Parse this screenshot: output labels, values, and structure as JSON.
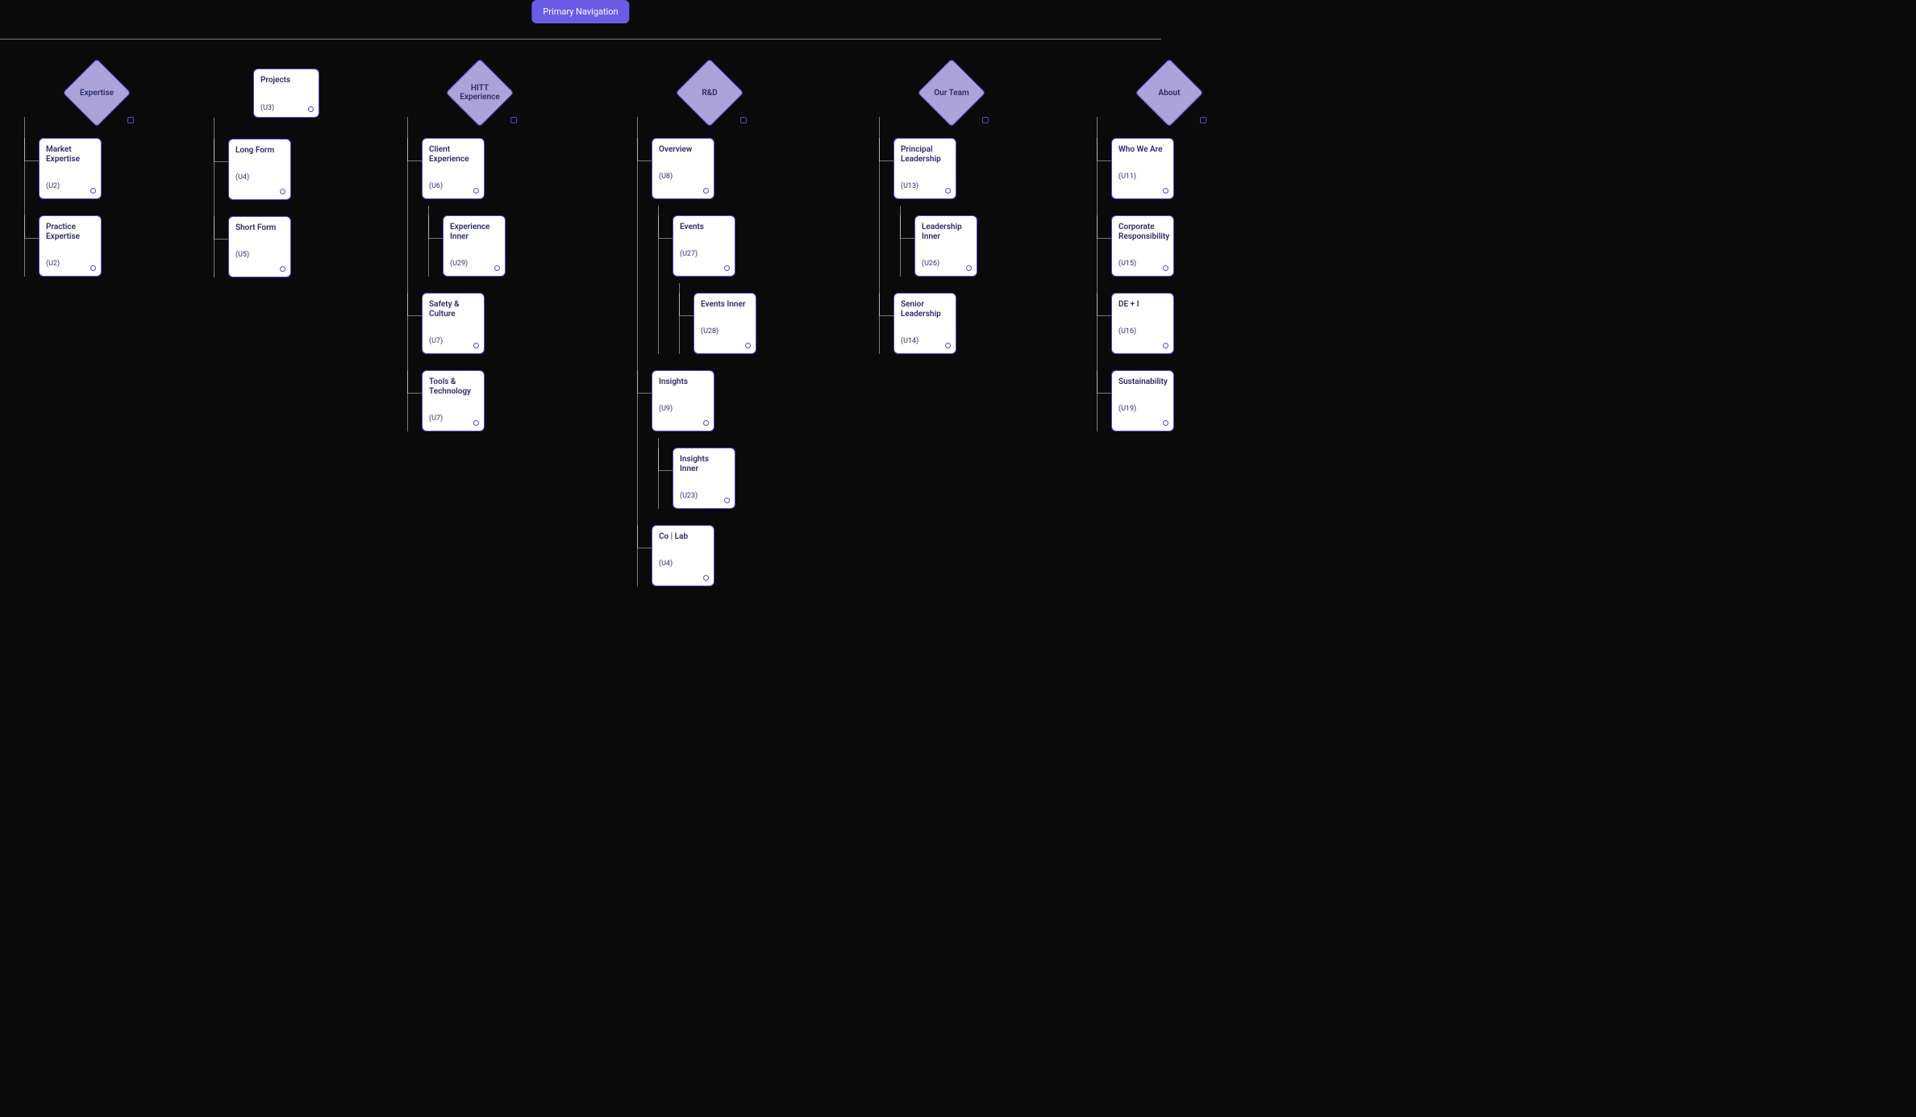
{
  "root_label": "Primary Navigation",
  "colors": {
    "accent": "#6B5CE6",
    "stroke": "#514ACB",
    "card_bg": "#FFFFFF",
    "canvas": "#0a0a0a"
  },
  "sections": [
    {
      "id": "expertise",
      "header_type": "diamond",
      "header_label": "Expertise",
      "children": [
        {
          "title": "Market Expertise",
          "code": "(U2)"
        },
        {
          "title": "Practice Expertise",
          "code": "(U2)"
        }
      ]
    },
    {
      "id": "projects",
      "header_type": "card",
      "header_label": "Projects",
      "header_code": "(U3)",
      "children": [
        {
          "title": "Long Form",
          "code": "(U4)"
        },
        {
          "title": "Short Form",
          "code": "(U5)"
        }
      ]
    },
    {
      "id": "hitt",
      "header_type": "diamond",
      "header_label": "HITT Experience",
      "children": [
        {
          "title": "Client Experience",
          "code": "(U6)",
          "children": [
            {
              "title": "Experience Inner",
              "code": "(U29)"
            }
          ]
        },
        {
          "title": "Safety & Culture",
          "code": "(U7)"
        },
        {
          "title": "Tools & Technology",
          "code": "(U7)"
        }
      ]
    },
    {
      "id": "rd",
      "header_type": "diamond",
      "header_label": "R&D",
      "children": [
        {
          "title": "Overview",
          "code": "(U8)",
          "children": [
            {
              "title": "Events",
              "code": "(U27)",
              "children": [
                {
                  "title": "Events Inner",
                  "code": "(U28)"
                }
              ]
            }
          ]
        },
        {
          "title": "Insights",
          "code": "(U9)",
          "children": [
            {
              "title": "Insights Inner",
              "code": "(U23)"
            }
          ]
        },
        {
          "title": "Co | Lab",
          "code": "(U4)"
        }
      ]
    },
    {
      "id": "team",
      "header_type": "diamond",
      "header_label": "Our Team",
      "children": [
        {
          "title": "Principal Leadership",
          "code": "(U13)",
          "children": [
            {
              "title": "Leadership Inner",
              "code": "(U26)"
            }
          ]
        },
        {
          "title": "Senior Leadership",
          "code": "(U14)"
        }
      ]
    },
    {
      "id": "about",
      "header_type": "diamond",
      "header_label": "About",
      "children": [
        {
          "title": "Who We Are",
          "code": "(U11)"
        },
        {
          "title": "Corporate Responsibility",
          "code": "(U15)"
        },
        {
          "title": "DE + I",
          "code": "(U16)"
        },
        {
          "title": "Sustainability",
          "code": "(U19)"
        }
      ]
    }
  ]
}
